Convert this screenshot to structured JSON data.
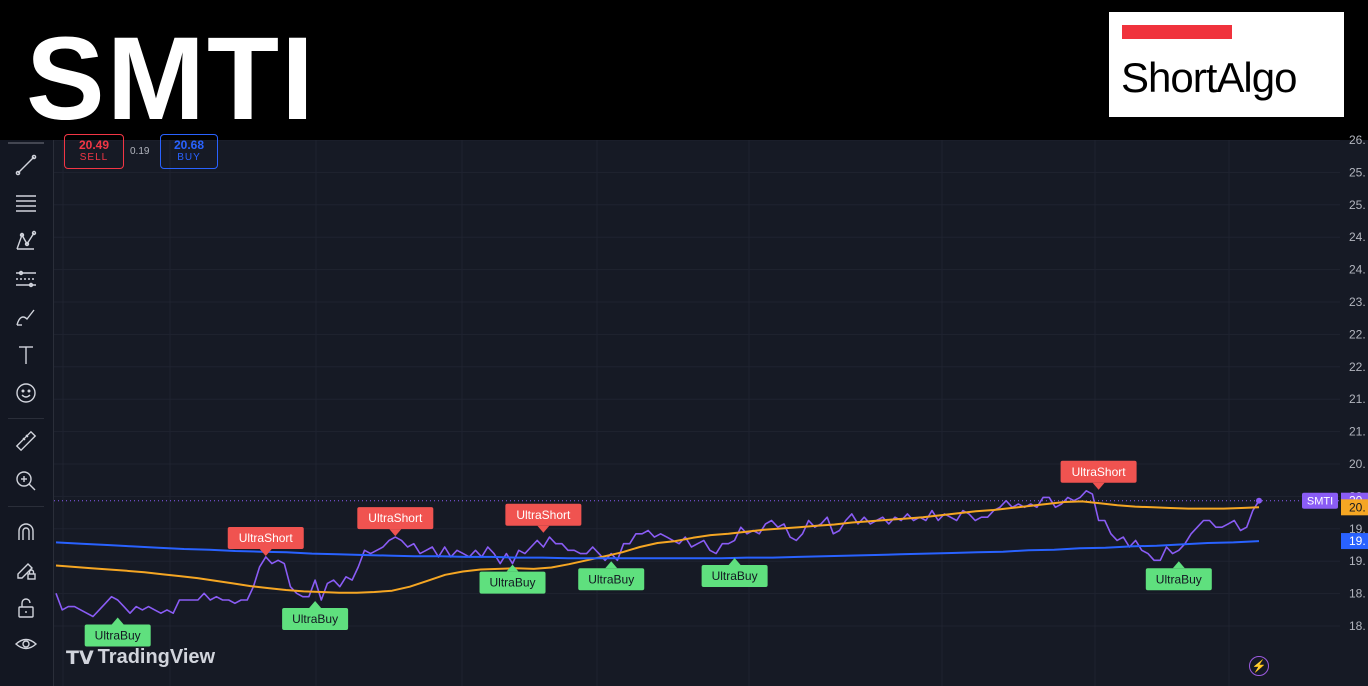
{
  "header": {
    "ticker": "SMTI"
  },
  "logo": {
    "text": "ShortAlgo",
    "bar_color": "#f0323c"
  },
  "order_panel": {
    "sell_price": "20.49",
    "sell_label": "SELL",
    "spread": "0.19",
    "buy_price": "20.68",
    "buy_label": "BUY"
  },
  "toolbar": {
    "icons": [
      "cursor-icon",
      "trend-line-icon",
      "fib-lines-icon",
      "pattern-icon",
      "forecast-icon",
      "brush-icon",
      "text-icon",
      "emoji-icon",
      "ruler-icon",
      "zoom-in-icon",
      "magnet-icon",
      "lock-drawing-icon",
      "lock-icon",
      "eye-icon"
    ]
  },
  "watermark": {
    "text": "TradingView",
    "mark": "TV"
  },
  "chart_data": {
    "type": "line",
    "ticker_label": "SMTI",
    "price_scale_ticks": [
      "26.",
      "25.",
      "25.",
      "24.",
      "24.",
      "23.",
      "22.",
      "22.",
      "21.",
      "21.",
      "20.",
      "20.",
      "19.",
      "19.",
      "18.",
      "18."
    ],
    "last_value_labels": {
      "price": "20.",
      "sma_fast": "20.",
      "sma_slow": "19."
    },
    "colors": {
      "price": "#8a5cf5",
      "sma_fast": "#f5a623",
      "sma_slow": "#2962ff",
      "short_signal": "#f05350",
      "buy_signal": "#5fe07e",
      "background": "#161a25"
    },
    "series": [
      {
        "key": "price",
        "values": [
          19.2,
          18.95,
          19.0,
          19.0,
          18.95,
          18.9,
          18.85,
          18.95,
          19.05,
          19.15,
          19.1,
          19.0,
          18.9,
          19.0,
          18.95,
          19.0,
          18.95,
          18.9,
          18.95,
          18.9,
          19.1,
          19.1,
          19.1,
          19.1,
          19.2,
          19.1,
          19.15,
          19.1,
          19.1,
          19.05,
          19.1,
          19.1,
          19.3,
          19.6,
          19.75,
          19.65,
          19.7,
          19.65,
          19.3,
          19.2,
          19.15,
          19.15,
          19.4,
          19.1,
          19.35,
          19.4,
          19.3,
          19.45,
          19.4,
          19.6,
          19.85,
          19.8,
          19.85,
          19.9,
          20.0,
          20.05,
          20.0,
          19.9,
          19.95,
          19.8,
          19.85,
          19.9,
          19.75,
          19.9,
          19.75,
          19.85,
          19.8,
          19.75,
          19.85,
          19.75,
          19.9,
          19.8,
          19.65,
          19.8,
          19.65,
          19.85,
          19.8,
          19.9,
          20.0,
          19.9,
          20.05,
          19.95,
          19.95,
          19.85,
          19.85,
          19.8,
          19.8,
          19.9,
          19.8,
          19.7,
          19.8,
          19.7,
          19.95,
          19.95,
          20.1,
          20.1,
          20.15,
          20.05,
          20.1,
          20.05,
          20.0,
          19.95,
          20.05,
          19.9,
          19.95,
          20.0,
          19.85,
          19.8,
          19.95,
          19.95,
          20.0,
          20.2,
          20.1,
          20.15,
          20.1,
          20.25,
          20.3,
          20.2,
          20.25,
          20.05,
          20.0,
          20.1,
          20.3,
          20.2,
          20.25,
          20.35,
          20.1,
          20.15,
          20.3,
          20.4,
          20.25,
          20.35,
          20.25,
          20.3,
          20.35,
          20.25,
          20.35,
          20.3,
          20.4,
          20.3,
          20.35,
          20.3,
          20.45,
          20.3,
          20.4,
          20.35,
          20.3,
          20.45,
          20.4,
          20.3,
          20.35,
          20.35,
          20.45,
          20.5,
          20.6,
          20.5,
          20.55,
          20.5,
          20.55,
          20.5,
          20.65,
          20.65,
          20.5,
          20.55,
          20.65,
          20.6,
          20.65,
          20.75,
          20.7,
          20.3,
          20.3,
          20.1,
          20.0,
          20.05,
          19.9,
          20.0,
          19.85,
          19.8,
          19.7,
          19.7,
          19.9,
          19.8,
          19.85,
          19.95,
          20.1,
          20.2,
          20.3,
          20.3,
          20.2,
          20.2,
          20.25,
          20.3,
          20.15,
          20.2,
          20.45,
          20.6
        ]
      },
      {
        "key": "sma_fast",
        "values": [
          19.62,
          19.6,
          19.58,
          19.56,
          19.54,
          19.52,
          19.49,
          19.46,
          19.43,
          19.39,
          19.35,
          19.31,
          19.28,
          19.25,
          19.23,
          19.22,
          19.21,
          19.21,
          19.22,
          19.24,
          19.3,
          19.39,
          19.48,
          19.53,
          19.56,
          19.57,
          19.58,
          19.57,
          19.59,
          19.64,
          19.7,
          19.76,
          19.82,
          19.9,
          19.96,
          19.99,
          20.04,
          20.08,
          20.1,
          20.13,
          20.16,
          20.18,
          20.2,
          20.22,
          20.24,
          20.27,
          20.29,
          20.31,
          20.33,
          20.35,
          20.38,
          20.41,
          20.44,
          20.46,
          20.49,
          20.52,
          20.55,
          20.58,
          20.59,
          20.56,
          20.53,
          20.51,
          20.5,
          20.49,
          20.48,
          20.48,
          20.48,
          20.49,
          20.5
        ]
      },
      {
        "key": "sma_slow",
        "values": [
          19.97,
          19.95,
          19.93,
          19.91,
          19.89,
          19.87,
          19.86,
          19.84,
          19.83,
          19.82,
          19.8,
          19.79,
          19.78,
          19.77,
          19.76,
          19.76,
          19.75,
          19.75,
          19.74,
          19.74,
          19.73,
          19.73,
          19.73,
          19.73,
          19.73,
          19.73,
          19.73,
          19.74,
          19.74,
          19.75,
          19.76,
          19.77,
          19.78,
          19.79,
          19.8,
          19.81,
          19.82,
          19.83,
          19.85,
          19.86,
          19.88,
          19.89,
          19.91,
          19.92,
          19.94,
          19.96,
          19.97,
          19.99
        ]
      }
    ],
    "annotations": [
      {
        "type": "short",
        "label": "UltraShort",
        "bar": 34,
        "price": 19.75
      },
      {
        "type": "short",
        "label": "UltraShort",
        "bar": 55,
        "price": 20.05
      },
      {
        "type": "short",
        "label": "UltraShort",
        "bar": 79,
        "price": 20.1
      },
      {
        "type": "short",
        "label": "UltraShort",
        "bar": 169,
        "price": 20.75
      },
      {
        "type": "buy",
        "label": "UltraBuy",
        "bar": 42,
        "price": 19.1
      },
      {
        "type": "buy",
        "label": "UltraBuy",
        "bar": 74,
        "price": 19.65
      },
      {
        "type": "buy",
        "label": "UltraBuy",
        "bar": 90,
        "price": 19.7
      },
      {
        "type": "buy",
        "label": "UltraBuy",
        "bar": 110,
        "price": 19.75
      },
      {
        "type": "buy",
        "label": "UltraBuy",
        "bar": 182,
        "price": 19.7
      },
      {
        "type": "buy",
        "label": "UltraBuy",
        "bar": 10,
        "price": 18.85
      }
    ],
    "ylim": [
      17.8,
      26.05
    ],
    "grid": true
  }
}
